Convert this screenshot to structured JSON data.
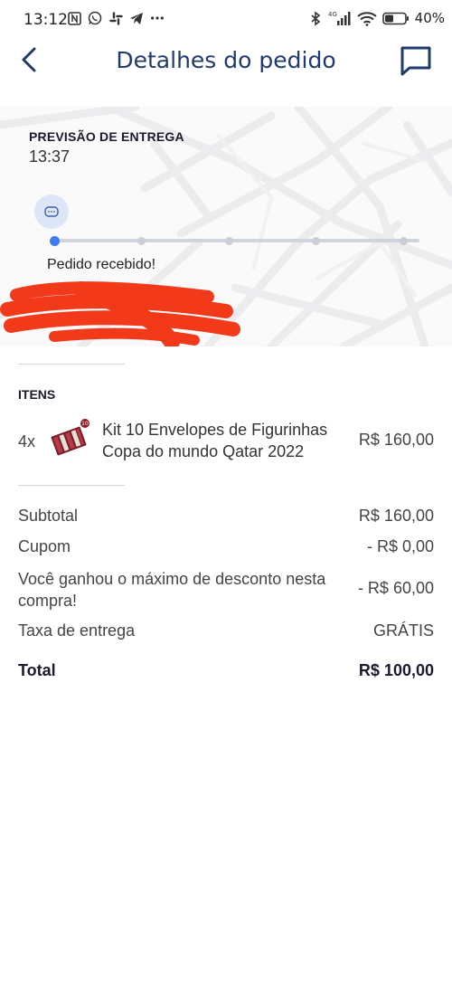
{
  "status_bar": {
    "time": "13:12",
    "left_icons": [
      "nfc-icon",
      "whatsapp-icon",
      "slack-icon",
      "telegram-icon",
      "more-dots-icon"
    ],
    "network": "4G",
    "battery": "40%"
  },
  "header": {
    "title": "Detalhes do pedido"
  },
  "tracking": {
    "eta_label": "PREVISÃO DE ENTREGA",
    "eta_time": "13:37",
    "step_status": "Pedido recebido!",
    "progress": 0.0,
    "steps_total": 5,
    "active_color": "#3d7bf0"
  },
  "items": {
    "title": "ITENS",
    "list": [
      {
        "qty": "4x",
        "name": "Kit 10 Envelopes de Figurinhas Copa do mundo Qatar 2022",
        "price": "R$ 160,00"
      }
    ]
  },
  "summary": {
    "subtotal_label": "Subtotal",
    "subtotal_value": "R$ 160,00",
    "coupon_label": "Cupom",
    "coupon_value": "- R$ 0,00",
    "discount_label": "Você ganhou o máximo de desconto nesta compra!",
    "discount_value": "- R$ 60,00",
    "delivery_label": "Taxa de entrega",
    "delivery_value": "GRÁTIS",
    "total_label": "Total",
    "total_value": "R$ 100,00"
  },
  "colors": {
    "brand": "#1f3a6d",
    "redaction": "#f2391a"
  }
}
